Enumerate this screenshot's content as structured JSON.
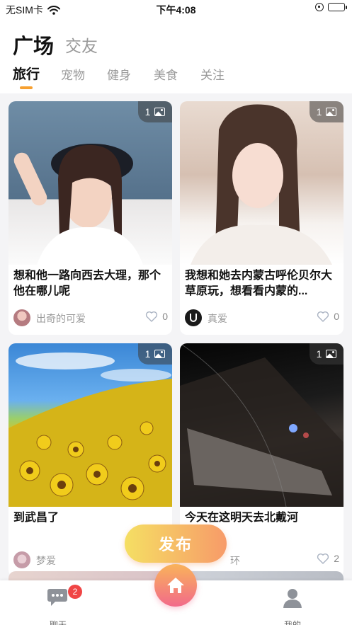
{
  "status_bar": {
    "carrier": "无SIM卡",
    "time": "下午4:08"
  },
  "header": {
    "title": "广场",
    "subtitle": "交友"
  },
  "tabs": [
    {
      "label": "旅行",
      "active": true
    },
    {
      "label": "宠物",
      "active": false
    },
    {
      "label": "健身",
      "active": false
    },
    {
      "label": "美食",
      "active": false
    },
    {
      "label": "关注",
      "active": false
    }
  ],
  "posts": [
    {
      "caption": "想和他一路向西去大理，那个他在哪儿呢",
      "author": "出奇的可爱",
      "likes": "0",
      "image_count": "1"
    },
    {
      "caption": "我想和她去内蒙古呼伦贝尔大草原玩，想看看内蒙的...",
      "author": "真爱",
      "likes": "0",
      "image_count": "1"
    },
    {
      "caption": "到武昌了",
      "author": "梦爱",
      "likes": "",
      "image_count": "1"
    },
    {
      "caption": "今天在这明天去北戴河",
      "author": "环",
      "likes": "2",
      "image_count": "1"
    }
  ],
  "publish_button": "发布",
  "tabbar": {
    "chat_label": "聊天",
    "chat_badge": "2",
    "me_label": "我的"
  },
  "colors": {
    "accent_orange": "#f7a030",
    "publish_gradient_start": "#f5df63",
    "publish_gradient_end": "#f79b69",
    "home_gradient_start": "#f9b35a",
    "home_gradient_end": "#f26a8a",
    "badge_red": "#f04545"
  }
}
